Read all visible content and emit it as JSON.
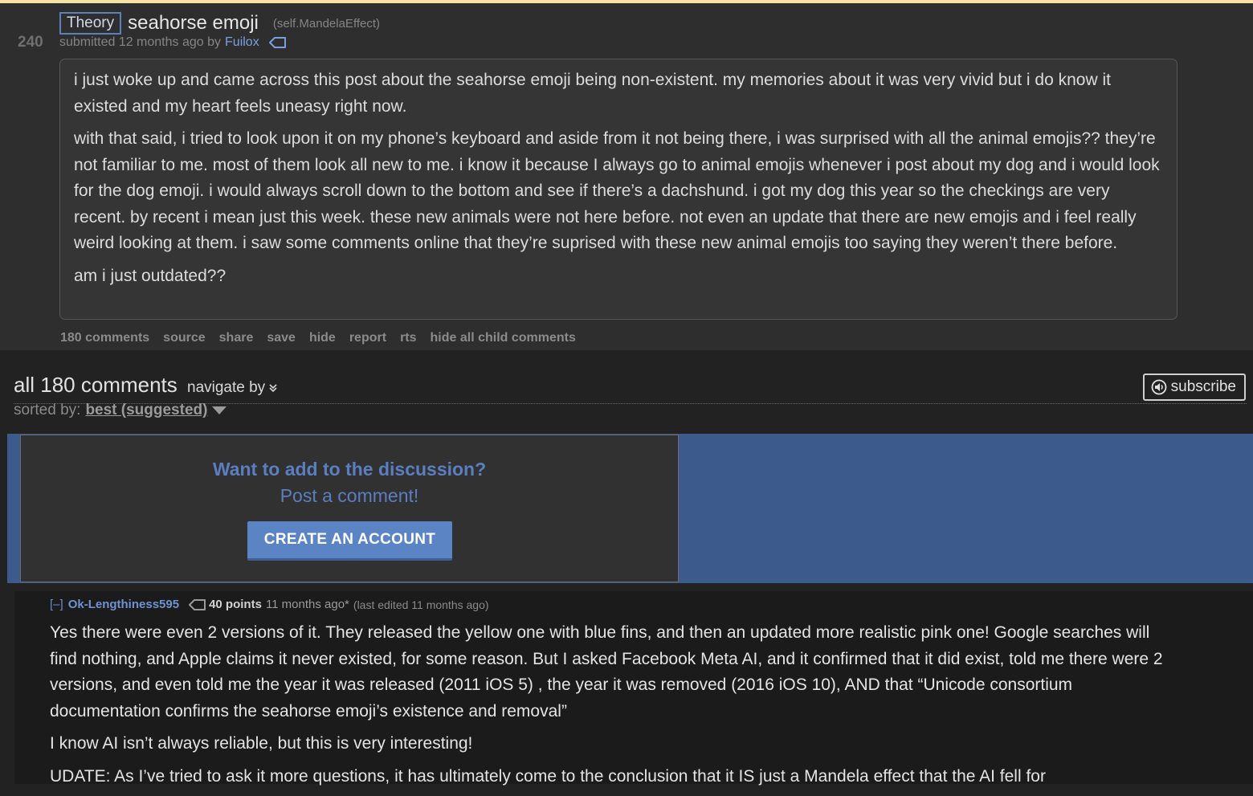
{
  "post": {
    "score": "240",
    "flair": "Theory",
    "title": "seahorse emoji",
    "domain": "(self.MandelaEffect)",
    "submitted_prefix": "submitted 12 months ago by",
    "author": "Fuilox",
    "selftext": [
      "i just woke up and came across this post about the seahorse emoji being non-existent. my memories about it was very vivid but i do know it existed and my heart feels uneasy right now.",
      "with that said, i tried to look upon it on my phone’s keyboard and aside from it not being there, i was surprised with all the animal emojis?? they’re not familiar to me. most of them look all new to me. i know it because I always go to animal emojis whenever i post about my dog and i would look for the dog emoji. i would always scroll down to the bottom and see if there’s a dachshund. i got my dog this year so the checkings are very recent. by recent i mean just this week. these new animals were not here before. not even an update that there are new emojis and i feel really weird looking at them. i saw some comments online that they’re suprised with these new animal emojis too saying they weren’t there before.",
      "am i just outdated??"
    ],
    "buttons": {
      "comments": "180 comments",
      "source": "source",
      "share": "share",
      "save": "save",
      "hide": "hide",
      "report": "report",
      "rts": "rts",
      "hide_children": "hide all child comments"
    }
  },
  "comments_header": {
    "title": "all 180 comments",
    "navigate": "navigate by",
    "subscribe": "subscribe",
    "sorted_label": "sorted by:",
    "sorted_value": "best (suggested)"
  },
  "banner": {
    "title": "Want to add to the discussion?",
    "subtitle": "Post a comment!",
    "button": "CREATE AN ACCOUNT"
  },
  "comment": {
    "expand": "[–]",
    "author": "Ok-Lengthiness595",
    "points": "40 points",
    "time": "11 months ago*",
    "edited": "(last edited 11 months ago)",
    "body": [
      "Yes there were even 2 versions of it. They released the yellow one with blue fins, and then an updated more realistic pink one! Google searches will find nothing, and Apple claims it never existed, for some reason. But I asked Facebook Meta AI, and it confirmed that it did exist, told me there were 2 versions, and even told me the year it was released (2011 iOS 5) , the year it was removed (2016 iOS 10), AND that “Unicode consortium documentation confirms the seahorse emoji’s existence and removal”",
      "I know AI isn’t always reliable, but this is very interesting!",
      "UDATE: As I’ve tried to ask it more questions, it has ultimately come to the conclusion that it IS just a Mandela effect that the AI fell for"
    ]
  },
  "colors": {
    "background": "#222222",
    "post_background": "#2e2e2e",
    "link_blue": "#7a9fe0",
    "banner_blue": "#3c5a8c",
    "button_blue": "#5b84c4"
  }
}
